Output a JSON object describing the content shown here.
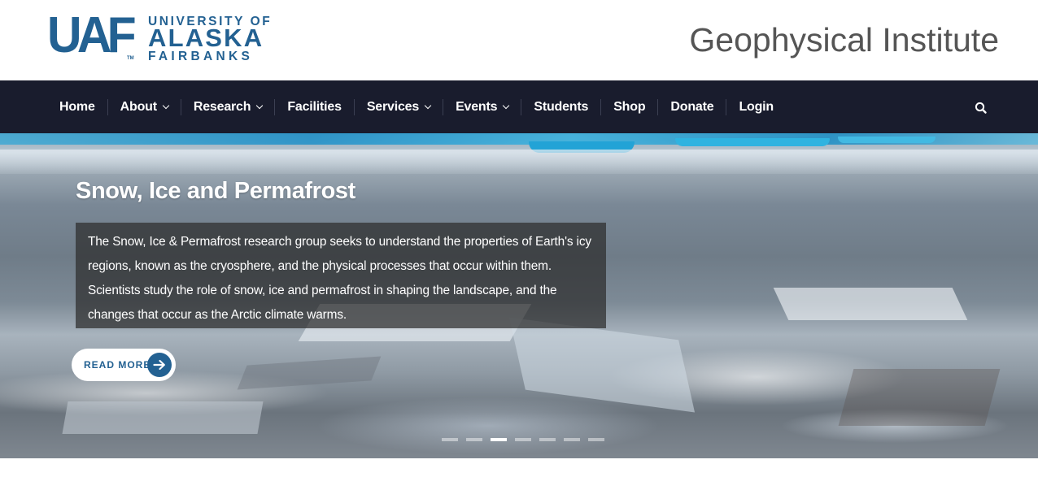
{
  "header": {
    "logo": {
      "mark_text": "UAF",
      "line1": "UNIVERSITY OF",
      "line2": "ALASKA",
      "line3": "FAIRBANKS",
      "tm": "TM"
    },
    "site_title": "Geophysical Institute"
  },
  "nav": {
    "items": [
      {
        "label": "Home",
        "has_dropdown": false
      },
      {
        "label": "About",
        "has_dropdown": true
      },
      {
        "label": "Research",
        "has_dropdown": true
      },
      {
        "label": "Facilities",
        "has_dropdown": false
      },
      {
        "label": "Services",
        "has_dropdown": true
      },
      {
        "label": "Events",
        "has_dropdown": true
      },
      {
        "label": "Students",
        "has_dropdown": false
      },
      {
        "label": "Shop",
        "has_dropdown": false
      },
      {
        "label": "Donate",
        "has_dropdown": false
      },
      {
        "label": "Login",
        "has_dropdown": false
      }
    ],
    "search_icon": "search-icon"
  },
  "hero": {
    "title": "Snow, Ice and Permafrost",
    "description": "The Snow, Ice & Permafrost research group seeks to understand the properties of Earth's icy regions, known as the cryosphere, and the physical processes that occur within them. Scientists study the role of snow, ice and permafrost in shaping the landscape, and the changes that occur as the Arctic climate warms.",
    "read_more_label": "READ MORE",
    "read_more_icon": "arrow-right-icon",
    "slide_count": 7,
    "active_slide": 3
  },
  "colors": {
    "brand_blue": "#236192",
    "nav_bg": "#191c2d",
    "title_gray": "#555555"
  }
}
